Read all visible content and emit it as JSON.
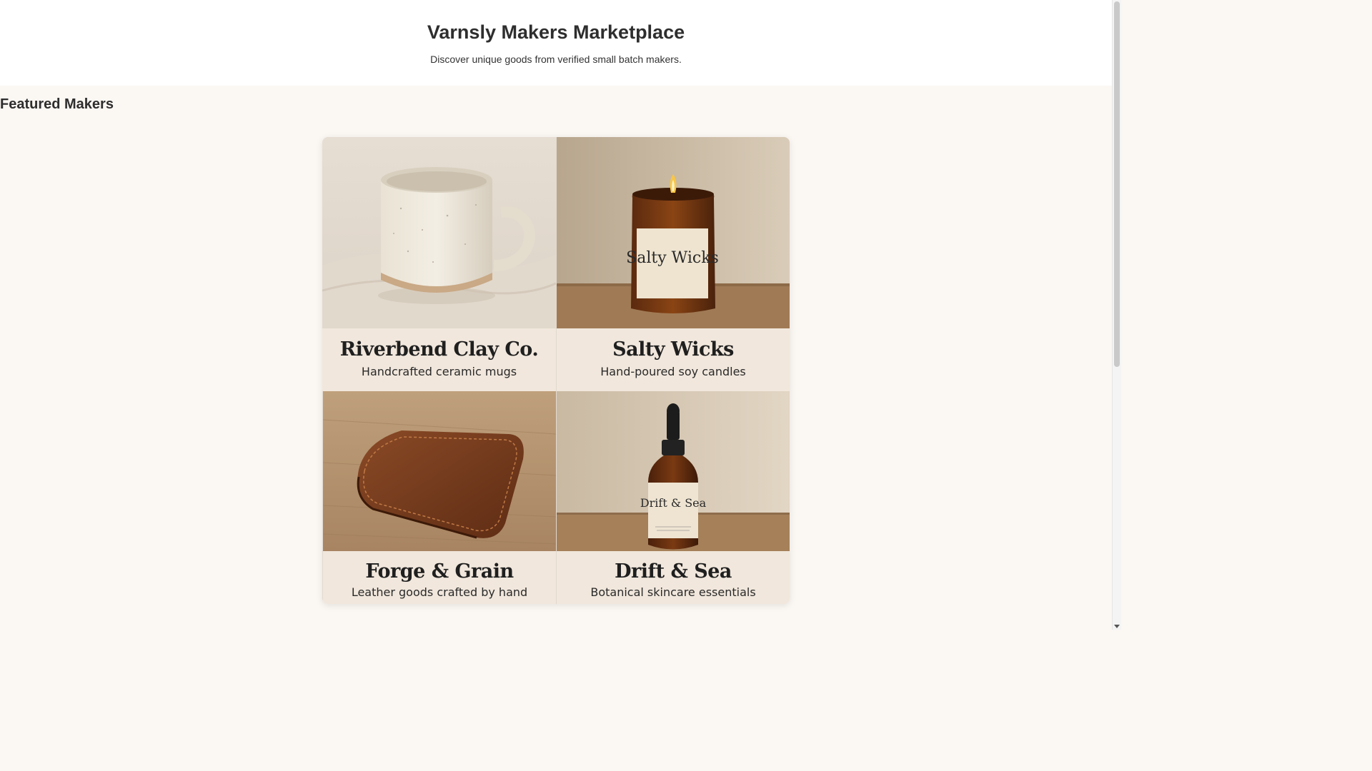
{
  "header": {
    "title": "Varnsly Makers Marketplace",
    "subtitle": "Discover unique goods from verified small batch makers."
  },
  "featured": {
    "heading": "Featured Makers",
    "makers": [
      {
        "name": "Riverbend Clay Co.",
        "tagline": "Handcrafted ceramic mugs",
        "photo_icon": "ceramic-mug-icon",
        "label_text": ""
      },
      {
        "name": "Salty Wicks",
        "tagline": "Hand-poured soy candles",
        "photo_icon": "candle-jar-icon",
        "label_text": "Salty Wicks"
      },
      {
        "name": "Forge & Grain",
        "tagline": "Leather goods crafted by hand",
        "photo_icon": "leather-wallet-icon",
        "label_text": ""
      },
      {
        "name": "Drift & Sea",
        "tagline": "Botanical skincare essentials",
        "photo_icon": "dropper-bottle-icon",
        "label_text": "Drift & Sea"
      }
    ]
  },
  "colors": {
    "page_background": "#fbf7f3",
    "header_background": "#ffffff",
    "caption_background": "#f1e7dc",
    "text": "#2b2b2b"
  }
}
